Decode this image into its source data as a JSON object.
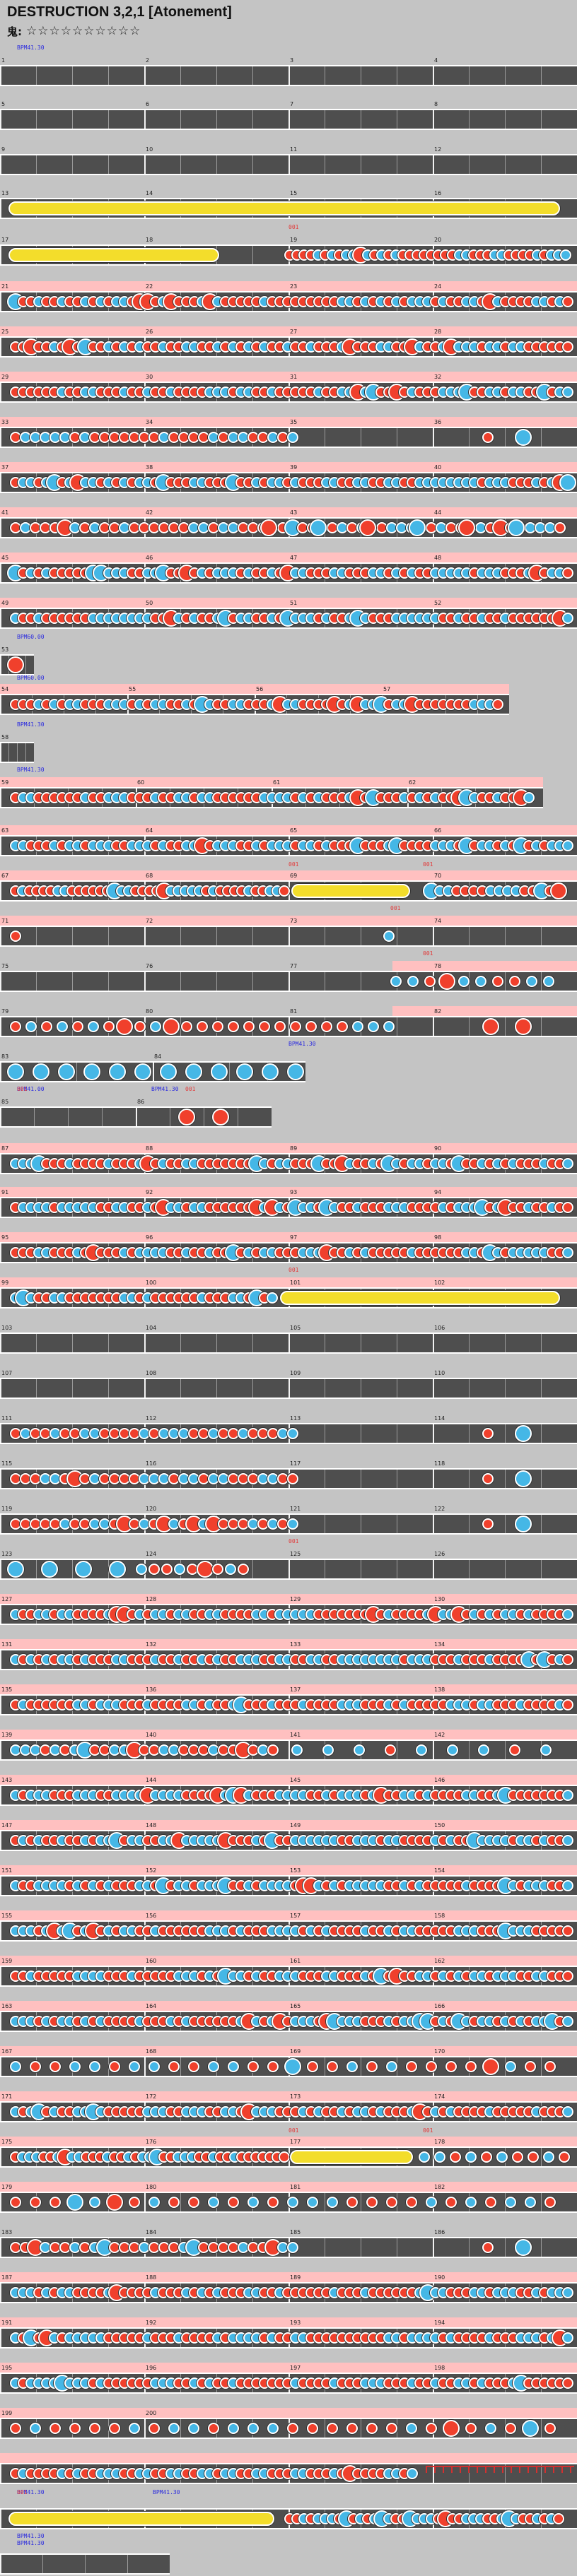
{
  "header": {
    "title": "DESTRUCTION 3,2,1 [Atonement]",
    "difficulty_label": "鬼:",
    "stars": "☆☆☆☆☆☆☆☆☆☆"
  },
  "colors": {
    "background": "#c4c4c4",
    "lane": "#4e4e4e",
    "lane_edge": "#ffffff",
    "gogo_band": "#ffc0c0",
    "don": "#f0402c",
    "ka": "#45b7e6",
    "drumroll": "#f3dd2b",
    "annotation_blue": "#2a2adf",
    "annotation_red": "#e23a3a"
  },
  "annotations": {
    "bpm_start": "BPM41.30",
    "bpm_2": "BPM60.00",
    "bpm_3": "BPM60.00",
    "bpm_4": "BPM41.30",
    "bpm_5": "BPM41.30",
    "bpm_6": "BPM41.30",
    "bpm_7": "BPM41.00",
    "bpm_8": "BPM41.30",
    "bpm_9": "BPM41.30",
    "bpm_10": "BPM41.30",
    "bpm_11": "BPM41.30",
    "bpm_12": "BPM41.30",
    "red_1": "001",
    "red_2": "001",
    "red_3": "001",
    "red_4": "001",
    "red_5": "001",
    "red_6": "001",
    "red_7": "001",
    "red_8": "001",
    "red_9": "001",
    "red_10": "001",
    "red_11": "001",
    "red_12": "001"
  },
  "measure_numbers": [
    "1",
    "2",
    "3",
    "4",
    "5",
    "6",
    "7",
    "8",
    "9",
    "10",
    "11",
    "12",
    "13",
    "14",
    "15",
    "16",
    "17",
    "18",
    "19",
    "20",
    "21",
    "22",
    "23",
    "24",
    "25",
    "26",
    "27",
    "28",
    "29",
    "30",
    "31",
    "32",
    "33",
    "34",
    "35",
    "36",
    "37",
    "38",
    "39",
    "40",
    "41",
    "42",
    "43",
    "44",
    "45",
    "46",
    "47",
    "48",
    "49",
    "50",
    "51",
    "52",
    "53",
    "54",
    "55",
    "56",
    "57",
    "58",
    "59",
    "60",
    "61",
    "62",
    "63",
    "64",
    "65",
    "66",
    "67",
    "68",
    "69",
    "70",
    "71",
    "72",
    "73",
    "74",
    "75",
    "76",
    "77",
    "78",
    "79",
    "80",
    "81",
    "82",
    "83",
    "84",
    "85",
    "86",
    "87",
    "88",
    "89",
    "90",
    "91",
    "92",
    "93",
    "94",
    "95",
    "96",
    "97",
    "98",
    "99",
    "100",
    "101",
    "102",
    "103",
    "104",
    "105",
    "106",
    "107",
    "108",
    "109",
    "110",
    "111",
    "112",
    "113",
    "114",
    "115",
    "116",
    "117",
    "118",
    "119",
    "120",
    "121",
    "122",
    "123",
    "124",
    "125",
    "126",
    "127",
    "128",
    "129",
    "130",
    "131",
    "132",
    "133",
    "134",
    "135",
    "136",
    "137",
    "138",
    "139",
    "140",
    "141",
    "142",
    "143",
    "144",
    "145",
    "146",
    "147",
    "148",
    "149",
    "150",
    "151",
    "152",
    "153",
    "154",
    "155",
    "156",
    "157",
    "158",
    "159",
    "160",
    "161",
    "162",
    "163",
    "164",
    "165",
    "166",
    "167",
    "168",
    "169",
    "170",
    "171",
    "172",
    "173",
    "174",
    "175",
    "176",
    "177",
    "178",
    "179",
    "180",
    "181",
    "182",
    "183",
    "184",
    "185",
    "186",
    "187",
    "188",
    "189",
    "190",
    "191",
    "192",
    "193",
    "194",
    "195",
    "196",
    "197",
    "198",
    "199",
    "200"
  ]
}
